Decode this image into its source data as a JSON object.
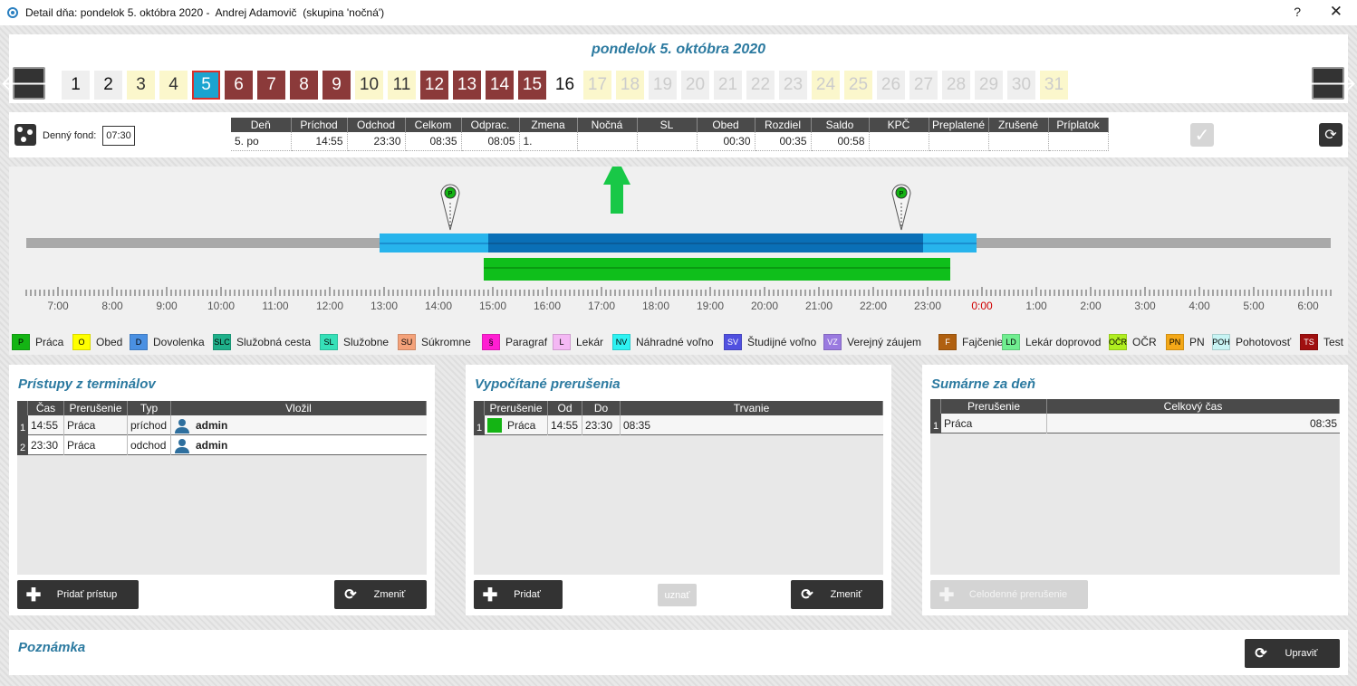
{
  "window": {
    "title": "Detail dňa: pondelok 5. októbra 2020 -  Andrej Adamovič  (skupina 'nočná')",
    "help": "?",
    "close": "✕"
  },
  "date_title": "pondelok 5. októbra 2020",
  "days": [
    {
      "n": "1",
      "style": "d-gray"
    },
    {
      "n": "2",
      "style": "d-gray"
    },
    {
      "n": "3",
      "style": "d-yellow"
    },
    {
      "n": "4",
      "style": "d-yellow"
    },
    {
      "n": "5",
      "style": "d-sel"
    },
    {
      "n": "6",
      "style": "d-red"
    },
    {
      "n": "7",
      "style": "d-red"
    },
    {
      "n": "8",
      "style": "d-red"
    },
    {
      "n": "9",
      "style": "d-red"
    },
    {
      "n": "10",
      "style": "d-yellow"
    },
    {
      "n": "11",
      "style": "d-yellow"
    },
    {
      "n": "12",
      "style": "d-red"
    },
    {
      "n": "13",
      "style": "d-red"
    },
    {
      "n": "14",
      "style": "d-red"
    },
    {
      "n": "15",
      "style": "d-red"
    },
    {
      "n": "16",
      "style": "d-wht"
    },
    {
      "n": "17",
      "style": "d-fy"
    },
    {
      "n": "18",
      "style": "d-fy"
    },
    {
      "n": "19",
      "style": "d-fg"
    },
    {
      "n": "20",
      "style": "d-fg"
    },
    {
      "n": "21",
      "style": "d-fg"
    },
    {
      "n": "22",
      "style": "d-fg"
    },
    {
      "n": "23",
      "style": "d-fg"
    },
    {
      "n": "24",
      "style": "d-fy"
    },
    {
      "n": "25",
      "style": "d-fy"
    },
    {
      "n": "26",
      "style": "d-fg"
    },
    {
      "n": "27",
      "style": "d-fg"
    },
    {
      "n": "28",
      "style": "d-fg"
    },
    {
      "n": "29",
      "style": "d-fg"
    },
    {
      "n": "30",
      "style": "d-fg"
    },
    {
      "n": "31",
      "style": "d-fy"
    }
  ],
  "fond": {
    "label": "Denný fond:",
    "value": "07:30"
  },
  "summary": {
    "headers": [
      "Deň",
      "Príchod",
      "Odchod",
      "Celkom",
      "Odprac.",
      "Zmena",
      "Nočná",
      "SL",
      "Obed",
      "Rozdiel",
      "Saldo",
      "KPČ",
      "Preplatené",
      "Zrušené",
      "Príplatok"
    ],
    "row": [
      "5. po",
      "14:55",
      "23:30",
      "08:35",
      "08:05",
      "1.",
      "",
      "",
      "00:30",
      "00:35",
      "00:58",
      "",
      "",
      "",
      ""
    ]
  },
  "timeline": {
    "ticks": [
      "7:00",
      "8:00",
      "9:00",
      "10:00",
      "11:00",
      "12:00",
      "13:00",
      "14:00",
      "15:00",
      "16:00",
      "17:00",
      "18:00",
      "19:00",
      "20:00",
      "21:00",
      "22:00",
      "23:00",
      "0:00",
      "1:00",
      "2:00",
      "3:00",
      "4:00",
      "5:00",
      "6:00"
    ],
    "pin_label": "P",
    "shift_outer": [
      "13:00",
      "23:59"
    ],
    "shift_core": [
      "15:00",
      "23:00"
    ],
    "work": [
      "14:55",
      "23:30"
    ],
    "colors": {
      "track": "#a9a9a9",
      "outer": "#27b4ec",
      "core": "#0a6fb6",
      "work": "#0fbf1b",
      "midnight": "#d00000",
      "arrow": "#18c847"
    }
  },
  "legend": [
    {
      "code": "P",
      "label": "Práca",
      "color": "#14b414"
    },
    {
      "code": "O",
      "label": "Obed",
      "color": "#ffff00"
    },
    {
      "code": "D",
      "label": "Dovolenka",
      "color": "#4a90e2"
    },
    {
      "code": "SLC",
      "label": "Služobná cesta",
      "color": "#1fb08a"
    },
    {
      "code": "SL",
      "label": "Služobne",
      "color": "#36e0b8"
    },
    {
      "code": "SU",
      "label": "Súkromne",
      "color": "#f4a27a"
    },
    {
      "code": "§",
      "label": "Paragraf",
      "color": "#ff1ed2"
    },
    {
      "code": "L",
      "label": "Lekár",
      "color": "#f4b8f4"
    },
    {
      "code": "NV",
      "label": "Náhradné voľno",
      "color": "#2ef2f2"
    },
    {
      "code": "SV",
      "label": "Študijné voľno",
      "color": "#5050e0"
    },
    {
      "code": "VZ",
      "label": "Verejný záujem",
      "color": "#9a7ae0"
    },
    {
      "code": "F",
      "label": "Fajčenie",
      "color": "#b06010"
    },
    {
      "code": "LD",
      "label": "Lekár doprovod",
      "color": "#70ee90"
    },
    {
      "code": "OČR",
      "label": "OČR",
      "color": "#b0ee20"
    },
    {
      "code": "PN",
      "label": "PN",
      "color": "#f4a818"
    },
    {
      "code": "POH",
      "label": "Pohotovosť",
      "color": "#c8f4f4"
    },
    {
      "code": "TS",
      "label": "Test",
      "color": "#a01010"
    }
  ],
  "pristupy": {
    "title": "Prístupy z terminálov",
    "headers": [
      "Čas",
      "Prerušenie",
      "Typ",
      "Vložil"
    ],
    "rows": [
      {
        "n": "1",
        "cas": "14:55",
        "prer": "Práca",
        "typ": "príchod",
        "vlozil": "admin"
      },
      {
        "n": "2",
        "cas": "23:30",
        "prer": "Práca",
        "typ": "odchod",
        "vlozil": "admin"
      }
    ],
    "add": "Pridať prístup",
    "change": "Zmeniť"
  },
  "vypocitane": {
    "title": "Vypočítané prerušenia",
    "headers": [
      "Prerušenie",
      "Od",
      "Do",
      "Trvanie"
    ],
    "rows": [
      {
        "n": "1",
        "prer": "Práca",
        "od": "14:55",
        "do": "23:30",
        "trv": "08:35",
        "color": "#14b414"
      }
    ],
    "add": "Pridať",
    "uznat": "uznať",
    "change": "Zmeniť"
  },
  "sumarne": {
    "title": "Sumárne za deň",
    "headers": [
      "Prerušenie",
      "Celkový čas"
    ],
    "rows": [
      {
        "n": "1",
        "prer": "Práca",
        "cas": "08:35"
      }
    ],
    "add": "Celodenné prerušenie"
  },
  "poznamka": {
    "title": "Poznámka",
    "edit": "Upraviť"
  }
}
